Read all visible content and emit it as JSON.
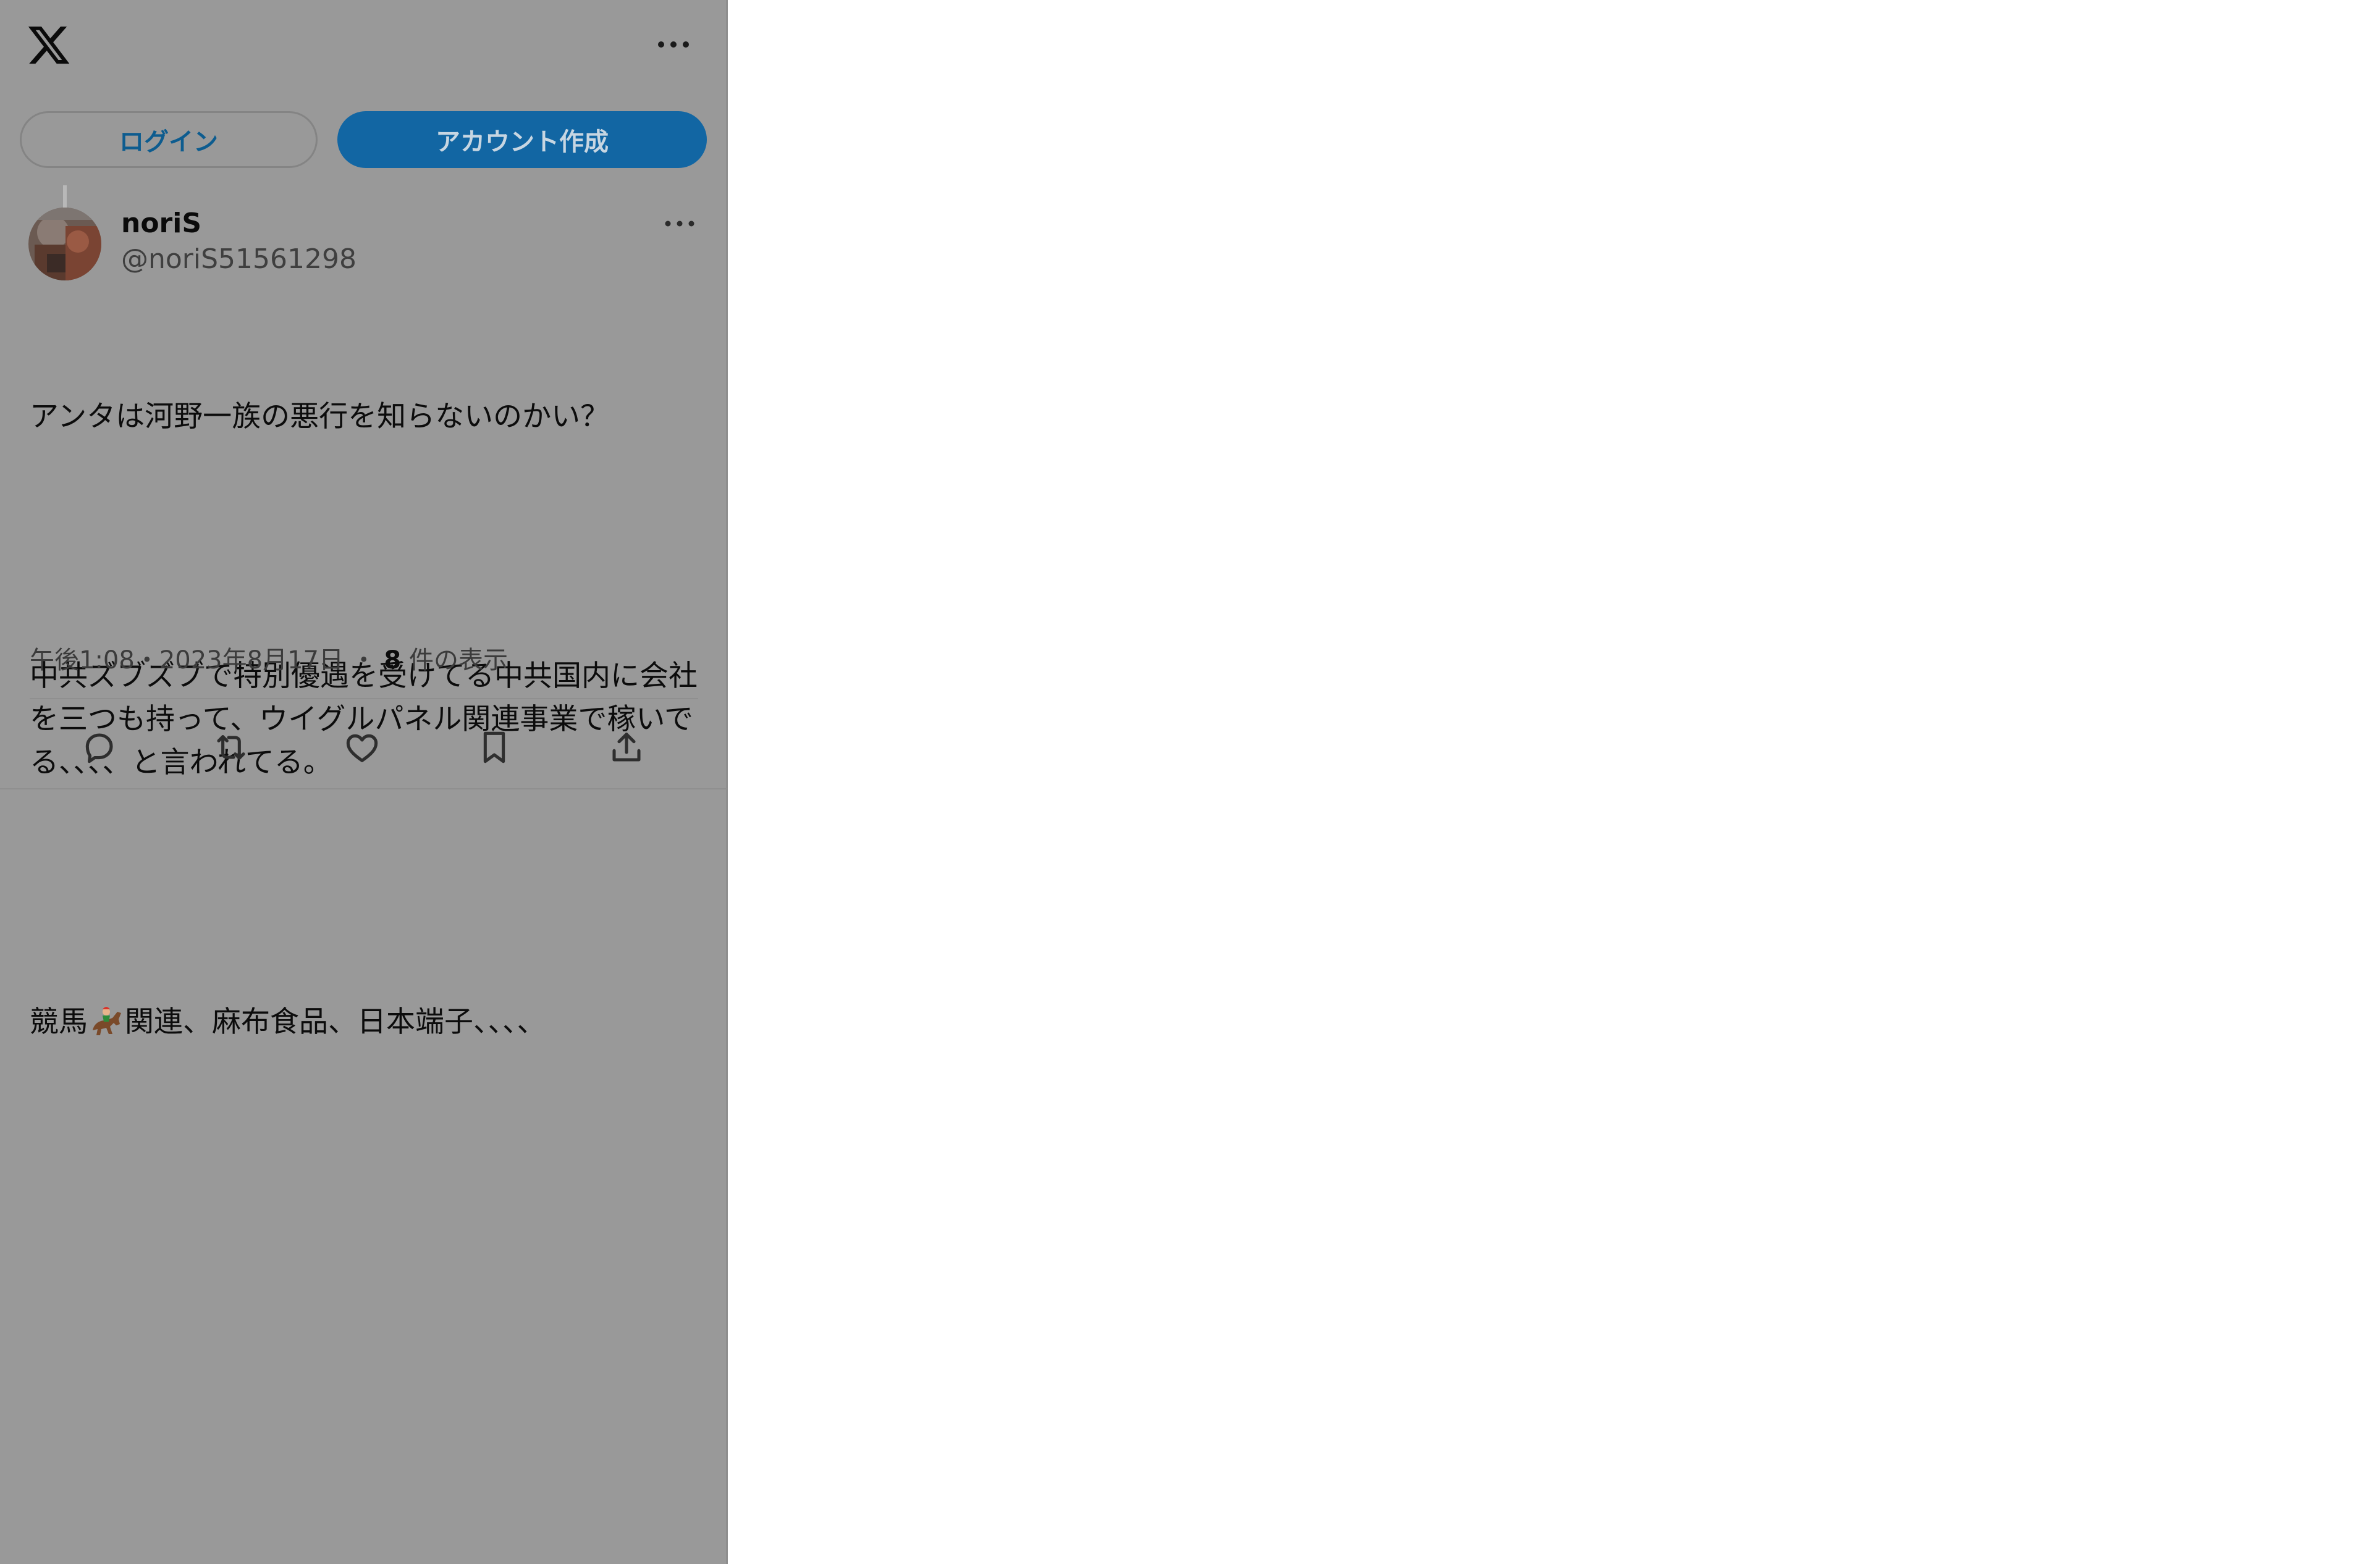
{
  "header": {
    "logo_icon": "x-logo-icon",
    "more_icon": "more-horizontal-icon"
  },
  "auth": {
    "login_label": "ログイン",
    "signup_label": "アカウント作成"
  },
  "tweet": {
    "display_name": "noriS",
    "handle": "@noriS51561298",
    "text_line1": "アンタは河野一族の悪行を知らないのかい？",
    "text_para2": "中共ズブズブで特別優遇を受けてる中共国内に会社を三つも持って、ウイグルパネル関連事業で稼いでる、、、、と言われてる。",
    "text_para3_before_emoji": "競馬",
    "text_para3_emoji": "horse-racing-emoji",
    "text_para3_after_emoji": "関連、麻布食品、日本端子、、、、",
    "timestamp": "午後1:08・2023年8月17日",
    "separator": "・",
    "view_count": "8",
    "view_suffix": " 件の表示"
  },
  "actions": {
    "reply_icon": "reply-icon",
    "retweet_icon": "retweet-icon",
    "like_icon": "heart-icon",
    "bookmark_icon": "bookmark-icon",
    "share_icon": "share-icon"
  },
  "colors": {
    "overlay": "#999999",
    "signup_button": "#1266a3",
    "login_text": "#0d5c8f"
  }
}
